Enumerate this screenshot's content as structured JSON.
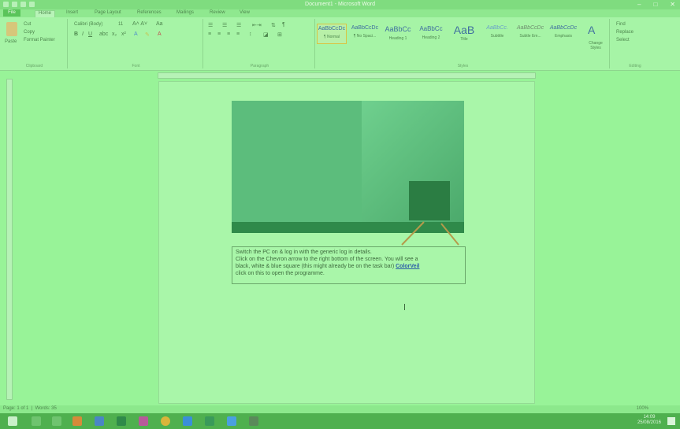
{
  "window": {
    "title": "Document1 - Microsoft Word",
    "minimize": "–",
    "maximize": "□",
    "close": "✕"
  },
  "ribbon_tabs": [
    "File",
    "Home",
    "Insert",
    "Page Layout",
    "References",
    "Mailings",
    "Review",
    "View"
  ],
  "clipboard": {
    "paste": "Paste",
    "cut": "Cut",
    "copy": "Copy",
    "format_painter": "Format Painter",
    "label": "Clipboard"
  },
  "font": {
    "name": "Calibri (Body)",
    "size": "11",
    "label": "Font"
  },
  "paragraph": {
    "label": "Paragraph"
  },
  "styles": {
    "label": "Styles",
    "items": [
      {
        "sample": "AaBbCcDc",
        "name": "¶ Normal"
      },
      {
        "sample": "AaBbCcDc",
        "name": "¶ No Spaci..."
      },
      {
        "sample": "AaBbCc",
        "name": "Heading 1"
      },
      {
        "sample": "AaBbCc",
        "name": "Heading 2"
      },
      {
        "sample": "AaB",
        "name": "Title"
      },
      {
        "sample": "AaBbCc.",
        "name": "Subtitle"
      },
      {
        "sample": "AaBbCcDc",
        "name": "Subtle Em..."
      },
      {
        "sample": "AaBbCcDc",
        "name": "Emphasis"
      }
    ],
    "change_styles": "Change Styles"
  },
  "editing": {
    "label": "Editing",
    "find": "Find",
    "replace": "Replace",
    "select": "Select"
  },
  "document": {
    "instructions_line1": "Switch the PC on & log in with the generic log in details.",
    "instructions_line2": "Click on the Chevron arrow to the right bottom of the screen. You will see a",
    "instructions_line3_pre": "black, white & blue square (this might already be on the task bar)",
    "instructions_link": "ColorVeil",
    "instructions_line4": "click on this to open the programme."
  },
  "statusbar": {
    "page": "Page: 1 of 1",
    "words": "Words: 35",
    "zoom": "100%"
  },
  "taskbar": {
    "time": "14:09",
    "date": "25/08/2016"
  }
}
